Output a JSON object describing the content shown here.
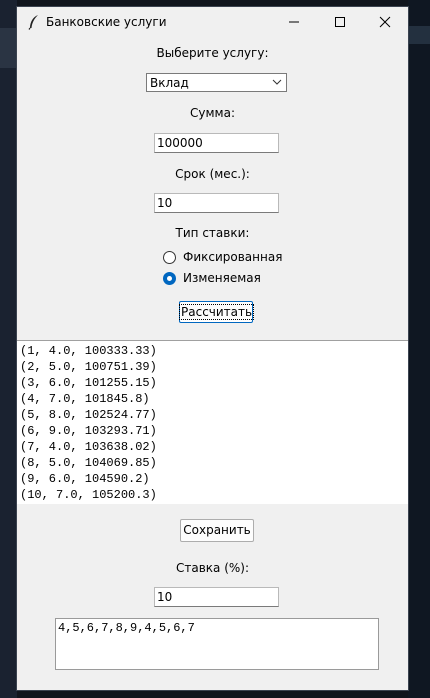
{
  "window": {
    "title": "Банковские услуги"
  },
  "form": {
    "service_label": "Выберите услугу:",
    "service_value": "Вклад",
    "sum_label": "Сумма:",
    "sum_value": "100000",
    "term_label": "Срок (мес.):",
    "term_value": "10",
    "rate_type_label": "Тип ставки:",
    "rate_options": [
      {
        "label": "Фиксированная",
        "selected": false
      },
      {
        "label": "Изменяемая",
        "selected": true
      }
    ],
    "calculate_label": "Рассчитать"
  },
  "output": {
    "rows": [
      "(1, 4.0, 100333.33)",
      "(2, 5.0, 100751.39)",
      "(3, 6.0, 101255.15)",
      "(4, 7.0, 101845.8)",
      "(5, 8.0, 102524.77)",
      "(6, 9.0, 103293.71)",
      "(7, 4.0, 103638.02)",
      "(8, 5.0, 104069.85)",
      "(9, 6.0, 104590.2)",
      "(10, 7.0, 105200.3)"
    ]
  },
  "bottom": {
    "save_label": "Сохранить",
    "rate_label": "Ставка (%):",
    "rate_value": "10",
    "rates_text": "4,5,6,7,8,9,4,5,6,7"
  },
  "colors": {
    "window_bg": "#f0f0f0",
    "accent": "#0067c0"
  }
}
